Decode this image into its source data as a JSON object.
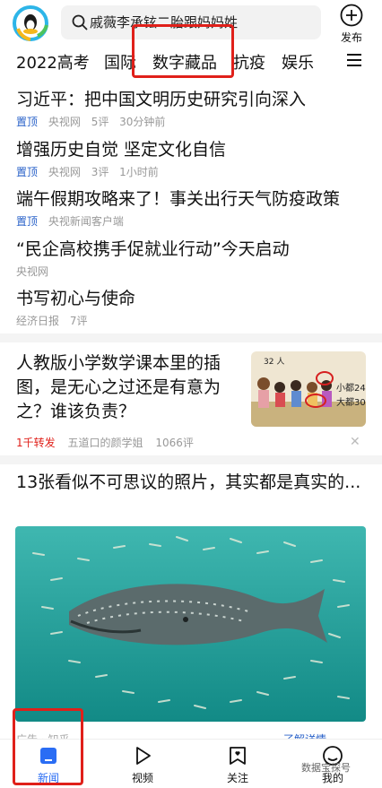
{
  "header": {
    "search_text": "戚薇李承铉二胎跟妈妈姓",
    "publish_label": "发布"
  },
  "tabs": [
    {
      "label": "2022高考"
    },
    {
      "label": "国际"
    },
    {
      "label": "数字藏品"
    },
    {
      "label": "抗疫"
    },
    {
      "label": "娱乐"
    }
  ],
  "news": [
    {
      "title": "习近平：把中国文明历史研究引向深入",
      "tag": "置顶",
      "source": "央视网",
      "comments": "5评",
      "time": "30分钟前"
    },
    {
      "title": "增强历史自觉 坚定文化自信",
      "tag": "置顶",
      "source": "央视网",
      "comments": "3评",
      "time": "1小时前"
    },
    {
      "title": "端午假期攻略来了！事关出行天气防疫政策",
      "tag": "置顶",
      "source": "央视新闻客户端",
      "comments": "",
      "time": ""
    },
    {
      "title": "“民企高校携手促就业行动”今天启动",
      "tag": "",
      "source": "央视网",
      "comments": "",
      "time": ""
    },
    {
      "title": "书写初心与使命",
      "tag": "",
      "source": "经济日报",
      "comments": "7评",
      "time": ""
    }
  ],
  "card1": {
    "title": "人教版小学数学课本里的插图，是无心之过还是有意为之？谁该负责？",
    "forwards": "1千转发",
    "source": "五道口的颜学姐",
    "comments": "1066评",
    "thumb_texts": [
      "32 人",
      "小都24",
      "大都30"
    ]
  },
  "card2": {
    "title": "13张看似不可思议的照片，其实都是真实的...",
    "meta": "广告 · 知乎",
    "more": "了解详情"
  },
  "bottom_nav": [
    {
      "label": "新闻"
    },
    {
      "label": "视频"
    },
    {
      "label": "关注"
    },
    {
      "label": "我的"
    }
  ],
  "watermark": "数据宝探号",
  "colors": {
    "accent": "#2a6df4",
    "highlight_box": "#e0201a",
    "pinned_tag": "#2a62c9"
  }
}
